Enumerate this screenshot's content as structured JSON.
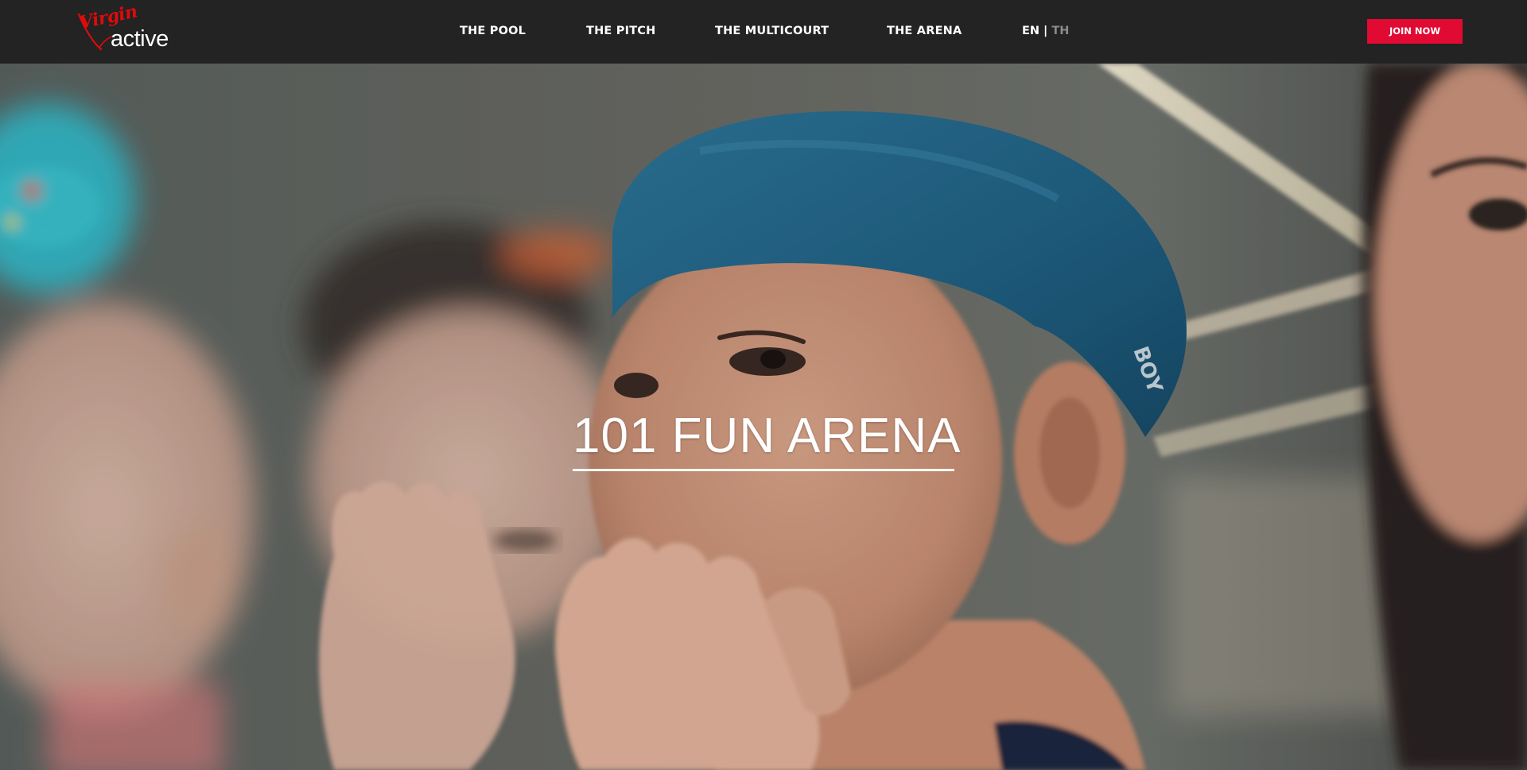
{
  "brand": {
    "logo_script": "Virgin",
    "logo_word": "active",
    "logo_color": "#e10a0a"
  },
  "nav": {
    "items": [
      {
        "label": "THE POOL"
      },
      {
        "label": "THE PITCH"
      },
      {
        "label": "THE MULTICOURT"
      },
      {
        "label": "THE ARENA"
      }
    ]
  },
  "language": {
    "active": "EN",
    "separator": "|",
    "inactive": "TH",
    "inactive_color": "#8a8a8a"
  },
  "cta": {
    "join_label": "JOIN NOW",
    "color": "#e10a32"
  },
  "hero": {
    "title": "101 FUN ARENA",
    "swim_cap_text": "BOY"
  },
  "colors": {
    "header_bg": "#232323",
    "text": "#ffffff"
  }
}
